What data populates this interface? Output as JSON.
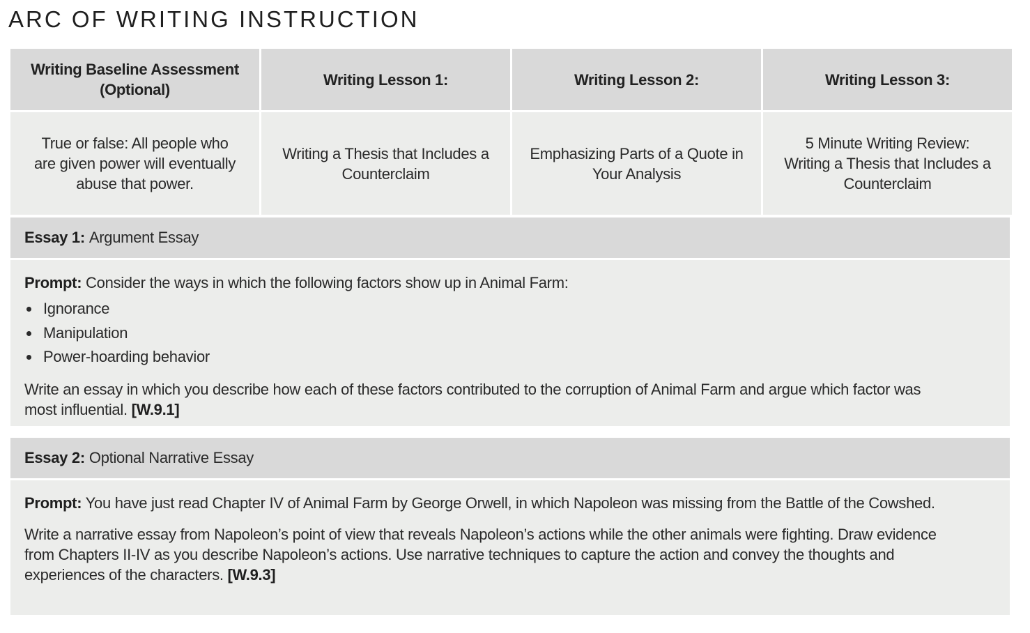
{
  "page_title": "ARC OF WRITING INSTRUCTION",
  "lessons_table": {
    "headers": [
      "Writing Baseline Assessment (Optional)",
      "Writing Lesson 1:",
      "Writing Lesson 2:",
      "Writing Lesson 3:"
    ],
    "descriptions": [
      "True or false: All people who are given power will eventually abuse that power.",
      "Writing a Thesis that Includes a Counterclaim",
      "Emphasizing Parts of a Quote in Your Analysis",
      "5 Minute Writing Review: Writing a Thesis that Includes a Counterclaim"
    ]
  },
  "essays": [
    {
      "label": "Essay 1:",
      "type": "Argument Essay",
      "prompt_label": "Prompt:",
      "prompt_text": "Consider the ways in which the following factors show up in Animal Farm:",
      "factors": [
        "Ignorance",
        "Manipulation",
        "Power-hoarding behavior"
      ],
      "instruction": "Write an essay in which you describe how each of these factors contributed to the corruption of Animal Farm and argue which factor was most influential.",
      "standard": "[W.9.1]"
    },
    {
      "label": "Essay 2:",
      "type": "Optional Narrative Essay",
      "prompt_label": "Prompt:",
      "prompt_text": "You have just read Chapter IV of Animal Farm by George Orwell, in which Napoleon was missing from the Battle of the Cowshed.",
      "instruction": "Write a narrative essay from Napoleon’s point of view that reveals Napoleon’s actions while the other animals were fighting. Draw evidence from Chapters II-IV as you describe Napoleon’s actions. Use narrative techniques to capture the action and convey the thoughts and experiences of the characters.",
      "standard": "[W.9.3]"
    }
  ]
}
